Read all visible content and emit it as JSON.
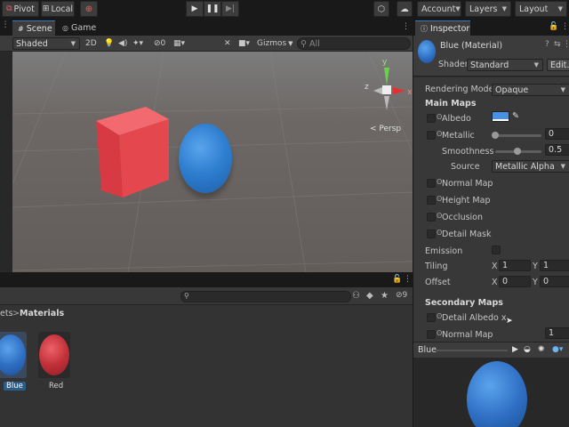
{
  "toolbar": {
    "pivot_label": "Pivot",
    "local_label": "Local",
    "account_label": "Account",
    "layers_label": "Layers",
    "layout_label": "Layout"
  },
  "scene": {
    "tabs": [
      {
        "label": "Scene"
      },
      {
        "label": "Game"
      }
    ],
    "shading_mode": "Shaded",
    "toggle_2d": "2D",
    "hidden_count": "0",
    "gizmos_label": "Gizmos",
    "search_placeholder": "All",
    "persp_label": "< Persp",
    "axis_labels": {
      "x": "x",
      "y": "y",
      "z": "z"
    },
    "objects": [
      {
        "name": "Cube",
        "color": "#e8434a"
      },
      {
        "name": "Sphere",
        "color": "#2f7fd1"
      }
    ]
  },
  "project": {
    "breadcrumb_root": "ets",
    "breadcrumb_sep": ">",
    "breadcrumb_current": "Materials",
    "hidden_count": "9",
    "assets": [
      {
        "label": "Blue",
        "color": "#2f6fc4",
        "selected": true
      },
      {
        "label": "Red",
        "color": "#c23038",
        "selected": false
      }
    ]
  },
  "inspector": {
    "tab_label": "Inspector",
    "material_title": "Blue (Material)",
    "shader_label": "Shader",
    "shader_value": "Standard",
    "edit_label": "Edit...",
    "rendering_mode_label": "Rendering Mode",
    "rendering_mode_value": "Opaque",
    "main_maps_label": "Main Maps",
    "albedo_label": "Albedo",
    "albedo_color": "#4a90e2",
    "metallic_label": "Metallic",
    "metallic_value": "0",
    "smoothness_label": "Smoothness",
    "smoothness_value": "0.5",
    "source_label": "Source",
    "source_value": "Metallic Alpha",
    "normal_map_label": "Normal Map",
    "height_map_label": "Height Map",
    "occlusion_label": "Occlusion",
    "detail_mask_label": "Detail Mask",
    "emission_label": "Emission",
    "tiling_label": "Tiling",
    "tiling_x": "1",
    "tiling_y": "1",
    "offset_label": "Offset",
    "offset_x": "0",
    "offset_y": "0",
    "x_label": "X",
    "y_label": "Y",
    "secondary_maps_label": "Secondary Maps",
    "detail_albedo_label": "Detail Albedo x",
    "secondary_normal_label": "Normal Map",
    "secondary_normal_value": "1",
    "preview_label": "Blue"
  }
}
